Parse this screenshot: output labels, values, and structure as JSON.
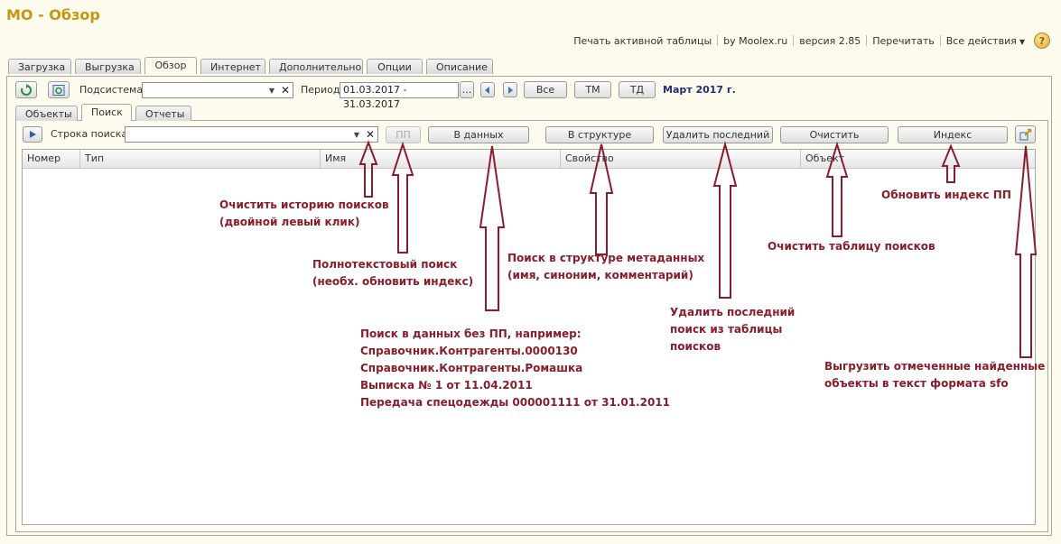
{
  "window": {
    "title": "МО - Обзор"
  },
  "top_actions": {
    "print": "Печать активной таблицы",
    "by": "by Moolex.ru",
    "version": "версия 2.85",
    "reread": "Перечитать",
    "all_actions": "Все действия",
    "help": "?"
  },
  "main_tabs": [
    "Загрузка",
    "Выгрузка",
    "Обзор",
    "Интернет",
    "Дополнительно",
    "Опции",
    "Описание"
  ],
  "toolbar": {
    "subsystem_label": "Подсистема:",
    "subsystem_value": "",
    "period_label": "Период:",
    "period_value": "01.03.2017 - 31.03.2017",
    "ellipsis": "...",
    "btn_all": "Все",
    "btn_tm": "ТМ",
    "btn_td": "ТД",
    "period_caption": "Март 2017 г."
  },
  "sub_tabs": [
    "Объекты",
    "Поиск",
    "Отчеты"
  ],
  "search": {
    "label": "Строка поиска:",
    "value": "",
    "btn_pp": "ПП",
    "btn_in_data": "В данных",
    "btn_in_structure": "В структуре",
    "btn_delete_last": "Удалить последний",
    "btn_clear": "Очистить",
    "btn_index": "Индекс"
  },
  "table": {
    "columns": [
      "Номер",
      "Тип",
      "Имя",
      "Свойство",
      "Объект"
    ]
  },
  "annotations": {
    "clear_history": [
      "Очистить историю поисков",
      "(двойной левый клик)"
    ],
    "fulltext": [
      "Полнотекстовый поиск",
      "(необх. обновить индекс)"
    ],
    "in_data": [
      "Поиск в данных без ПП, например:",
      "Справочник.Контрагенты.0000130",
      "Справочник.Контрагенты.Ромашка",
      "Выписка № 1 от 11.04.2011",
      "Передача спецодежды 000001111 от 31.01.2011"
    ],
    "in_structure": [
      "Поиск в структуре метаданных",
      "(имя, синоним, комментарий)"
    ],
    "delete_last": [
      "Удалить последний",
      "поиск из таблицы",
      "поисков"
    ],
    "clear_table": [
      "Очистить таблицу поисков"
    ],
    "update_index": [
      "Обновить индекс ПП"
    ],
    "export": [
      "Выгрузить отмеченные найденные",
      "объекты в текст формата sfo"
    ]
  },
  "colors": {
    "annotation": "#8a1d2c",
    "title": "#c8960f",
    "period_caption": "#1f2f7a",
    "background": "#fdfbee"
  }
}
